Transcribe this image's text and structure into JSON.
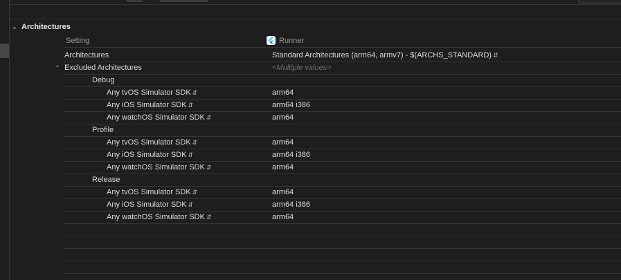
{
  "section": {
    "title": "Architectures"
  },
  "table": {
    "col_setting": "Setting",
    "col_target": "Runner"
  },
  "rows": {
    "architectures": {
      "name": "Architectures",
      "value": "Standard Architectures (arm64, armv7)  -  $(ARCHS_STANDARD)"
    },
    "excluded": {
      "name": "Excluded Architectures",
      "value": "<Multiple values>"
    },
    "configs": [
      {
        "name": "Debug",
        "sdks": [
          {
            "name": "Any tvOS Simulator SDK",
            "value": "arm64"
          },
          {
            "name": "Any iOS Simulator SDK",
            "value": "arm64 i386"
          },
          {
            "name": "Any watchOS Simulator SDK",
            "value": "arm64"
          }
        ]
      },
      {
        "name": "Profile",
        "sdks": [
          {
            "name": "Any tvOS Simulator SDK",
            "value": "arm64"
          },
          {
            "name": "Any iOS Simulator SDK",
            "value": "arm64 i386"
          },
          {
            "name": "Any watchOS Simulator SDK",
            "value": "arm64"
          }
        ]
      },
      {
        "name": "Release",
        "sdks": [
          {
            "name": "Any tvOS Simulator SDK",
            "value": "arm64"
          },
          {
            "name": "Any iOS Simulator SDK",
            "value": "arm64 i386"
          },
          {
            "name": "Any watchOS Simulator SDK",
            "value": "arm64"
          }
        ]
      }
    ]
  },
  "icons": {
    "section_disclosure": "chevron-down-icon",
    "row_disclosure": "chevron-down-icon",
    "stepper": "up-down-stepper-icon",
    "target": "flutter-app-icon"
  },
  "colors": {
    "background": "#1e1e1e",
    "separator": "#343434",
    "text": "#dcdcdc",
    "header_text": "#9a9a9a",
    "placeholder": "#6e6e6e"
  }
}
